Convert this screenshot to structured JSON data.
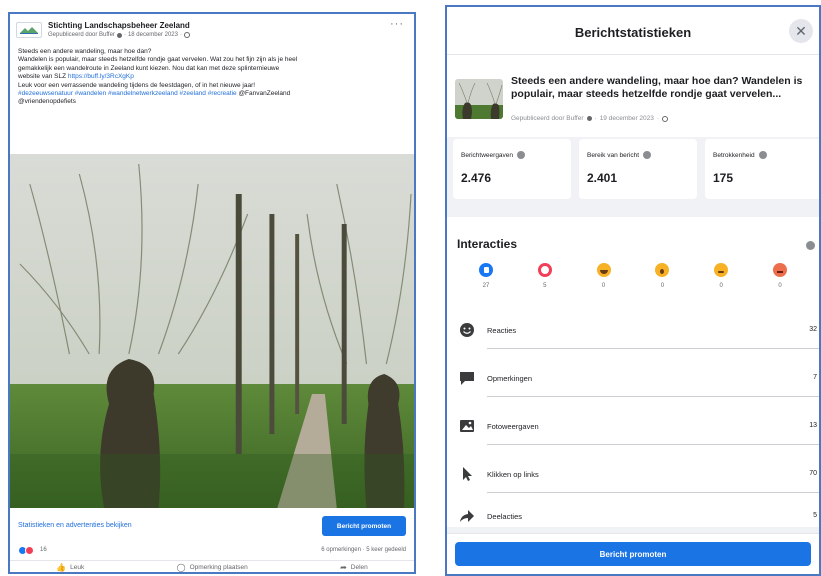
{
  "post": {
    "page_name": "Stichting Landschapsbeheer Zeeland",
    "meta_published_by": "Gepubliceerd door Buffer",
    "meta_date": "18 december 2023",
    "more_icon": "more-horizontal-icon",
    "text_lines": [
      "Steeds een andere wandeling, maar hoe dan?",
      "Wandelen is populair, maar steeds hetzelfde rondje gaat vervelen. Wat zou het fijn zijn als je heel",
      "gemakkelijk een wandelroute in Zeeland kunt kiezen. Nou dat kan met deze splinternieuwe",
      "website van SLZ"
    ],
    "link_text": "https://buff.ly/3RcXgKp",
    "text_line_after": "Leuk voor een verrassende wandeling tijdens de feestdagen, of in het nieuwe jaar!",
    "hashtags": "#dezeeuwsenatuur #wandelen #wandelnetwerkzeeland #zeeland #recreatie",
    "mention_1": "@FanvanZeeland",
    "mention_2": "@vriendenopdefiets",
    "insights_link": "Statistieken en advertenties bekijken",
    "promote_label": "Bericht promoten",
    "reaction_count": "16",
    "comments_shares": "6 opmerkingen · 5 keer gedeeld",
    "buttons": {
      "like": "Leuk",
      "comment": "Opmerking plaatsen",
      "share": "Delen"
    }
  },
  "modal": {
    "title": "Berichtstatistieken",
    "close_icon": "close-icon",
    "preview_text": "Steeds een andere wandeling, maar hoe dan? Wandelen is populair, maar steeds hetzelfde rondje gaat vervelen...",
    "preview_meta_by": "Gepubliceerd door Buffer",
    "preview_meta_date": "19 december 2023",
    "stats": [
      {
        "label": "Berichtweergaven",
        "value": "2.476"
      },
      {
        "label": "Bereik van bericht",
        "value": "2.401"
      },
      {
        "label": "Betrokkenheid",
        "value": "175"
      }
    ],
    "interactions_title": "Interacties",
    "reactions": [
      {
        "name": "like",
        "count": "27"
      },
      {
        "name": "love",
        "count": "5"
      },
      {
        "name": "haha",
        "count": "0"
      },
      {
        "name": "wow",
        "count": "0"
      },
      {
        "name": "sad",
        "count": "0"
      },
      {
        "name": "angry",
        "count": "0"
      }
    ],
    "rows": [
      {
        "label": "Reacties",
        "value": "32",
        "icon": "smiley-icon"
      },
      {
        "label": "Opmerkingen",
        "value": "7",
        "icon": "comment-icon"
      },
      {
        "label": "Fotoweergaven",
        "value": "13",
        "icon": "photo-icon"
      },
      {
        "label": "Klikken op links",
        "value": "70",
        "icon": "cursor-icon"
      },
      {
        "label": "Deelacties",
        "value": "5",
        "icon": "share-icon"
      }
    ],
    "promote_label": "Bericht promoten"
  },
  "colors": {
    "accent": "#1b74e4",
    "frame": "#4a78c2",
    "link": "#216fdb"
  }
}
